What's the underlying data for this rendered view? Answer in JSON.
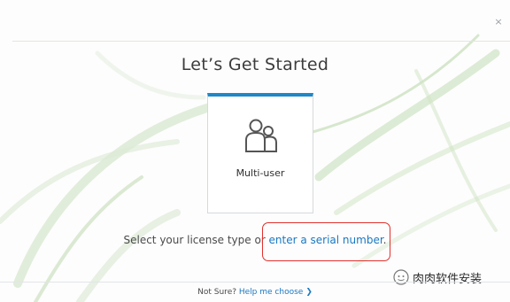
{
  "window": {
    "close_glyph": "×"
  },
  "header": {
    "title": "Let’s Get Started"
  },
  "license_option": {
    "label": "Multi-user",
    "icon": "multi-user-icon",
    "accent_color": "#1e88c8"
  },
  "prompt": {
    "text_before": "Select your license type or ",
    "link_label": "enter a serial number",
    "text_after": "."
  },
  "footer": {
    "question": "Not Sure? ",
    "link_label": "Help me choose",
    "chevron": "❯"
  },
  "annotation": {
    "highlight_color": "#e0312d"
  },
  "watermark": {
    "text": "肉肉软件安装"
  }
}
